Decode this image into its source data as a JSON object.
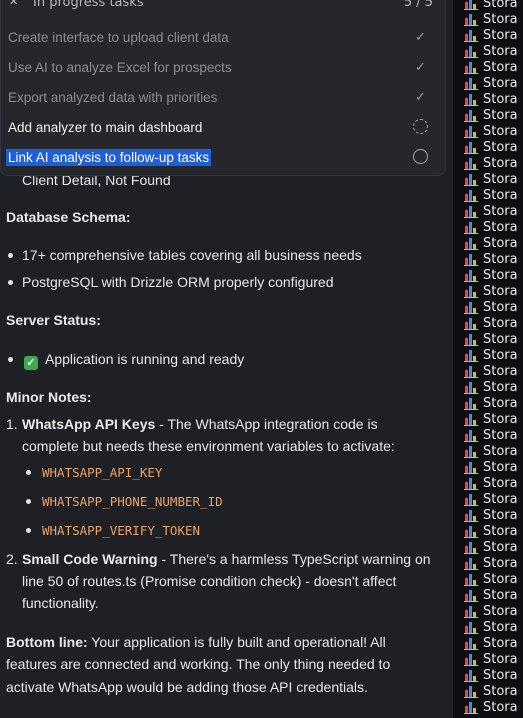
{
  "tasks": {
    "title": "In progress tasks",
    "count": "5 / 5",
    "items": [
      {
        "label": "Create interface to upload client data",
        "status": "done"
      },
      {
        "label": "Use AI to analyze Excel for prospects",
        "status": "done"
      },
      {
        "label": "Export analyzed data with priorities",
        "status": "done"
      },
      {
        "label": "Add analyzer to main dashboard",
        "status": "in-progress"
      },
      {
        "label": "Link AI analysis to follow-up tasks",
        "status": "pending"
      }
    ]
  },
  "content": {
    "partial_line": "Client Detail, Not Found",
    "db_heading": "Database Schema:",
    "db_items": [
      "17+ comprehensive tables covering all business needs",
      "PostgreSQL with Drizzle ORM properly configured"
    ],
    "server_heading": "Server Status:",
    "server_item": "Application is running and ready",
    "notes_heading": "Minor Notes:",
    "note1": {
      "number": "1.",
      "title": "WhatsApp API Keys",
      "line1": " - The WhatsApp integration code is",
      "line2": "complete but needs these environment variables to activate:",
      "vars": [
        "WHATSAPP_API_KEY",
        "WHATSAPP_PHONE_NUMBER_ID",
        "WHATSAPP_VERIFY_TOKEN"
      ]
    },
    "note2": {
      "number": "2.",
      "title": "Small Code Warning",
      "line1": " - There's a harmless TypeScript warning on",
      "line2": "line 50 of routes.ts (Promise condition check) - doesn't affect",
      "line3": "functionality."
    },
    "bottom": {
      "label": "Bottom line:",
      "line1": " Your application is fully built and operational! All",
      "line2": "features are connected and working. The only thing needed to",
      "line3": "activate WhatsApp would be adding those API credentials."
    }
  },
  "right_panel": {
    "item_label": "Stora",
    "icon": "bar-chart-icon"
  }
}
